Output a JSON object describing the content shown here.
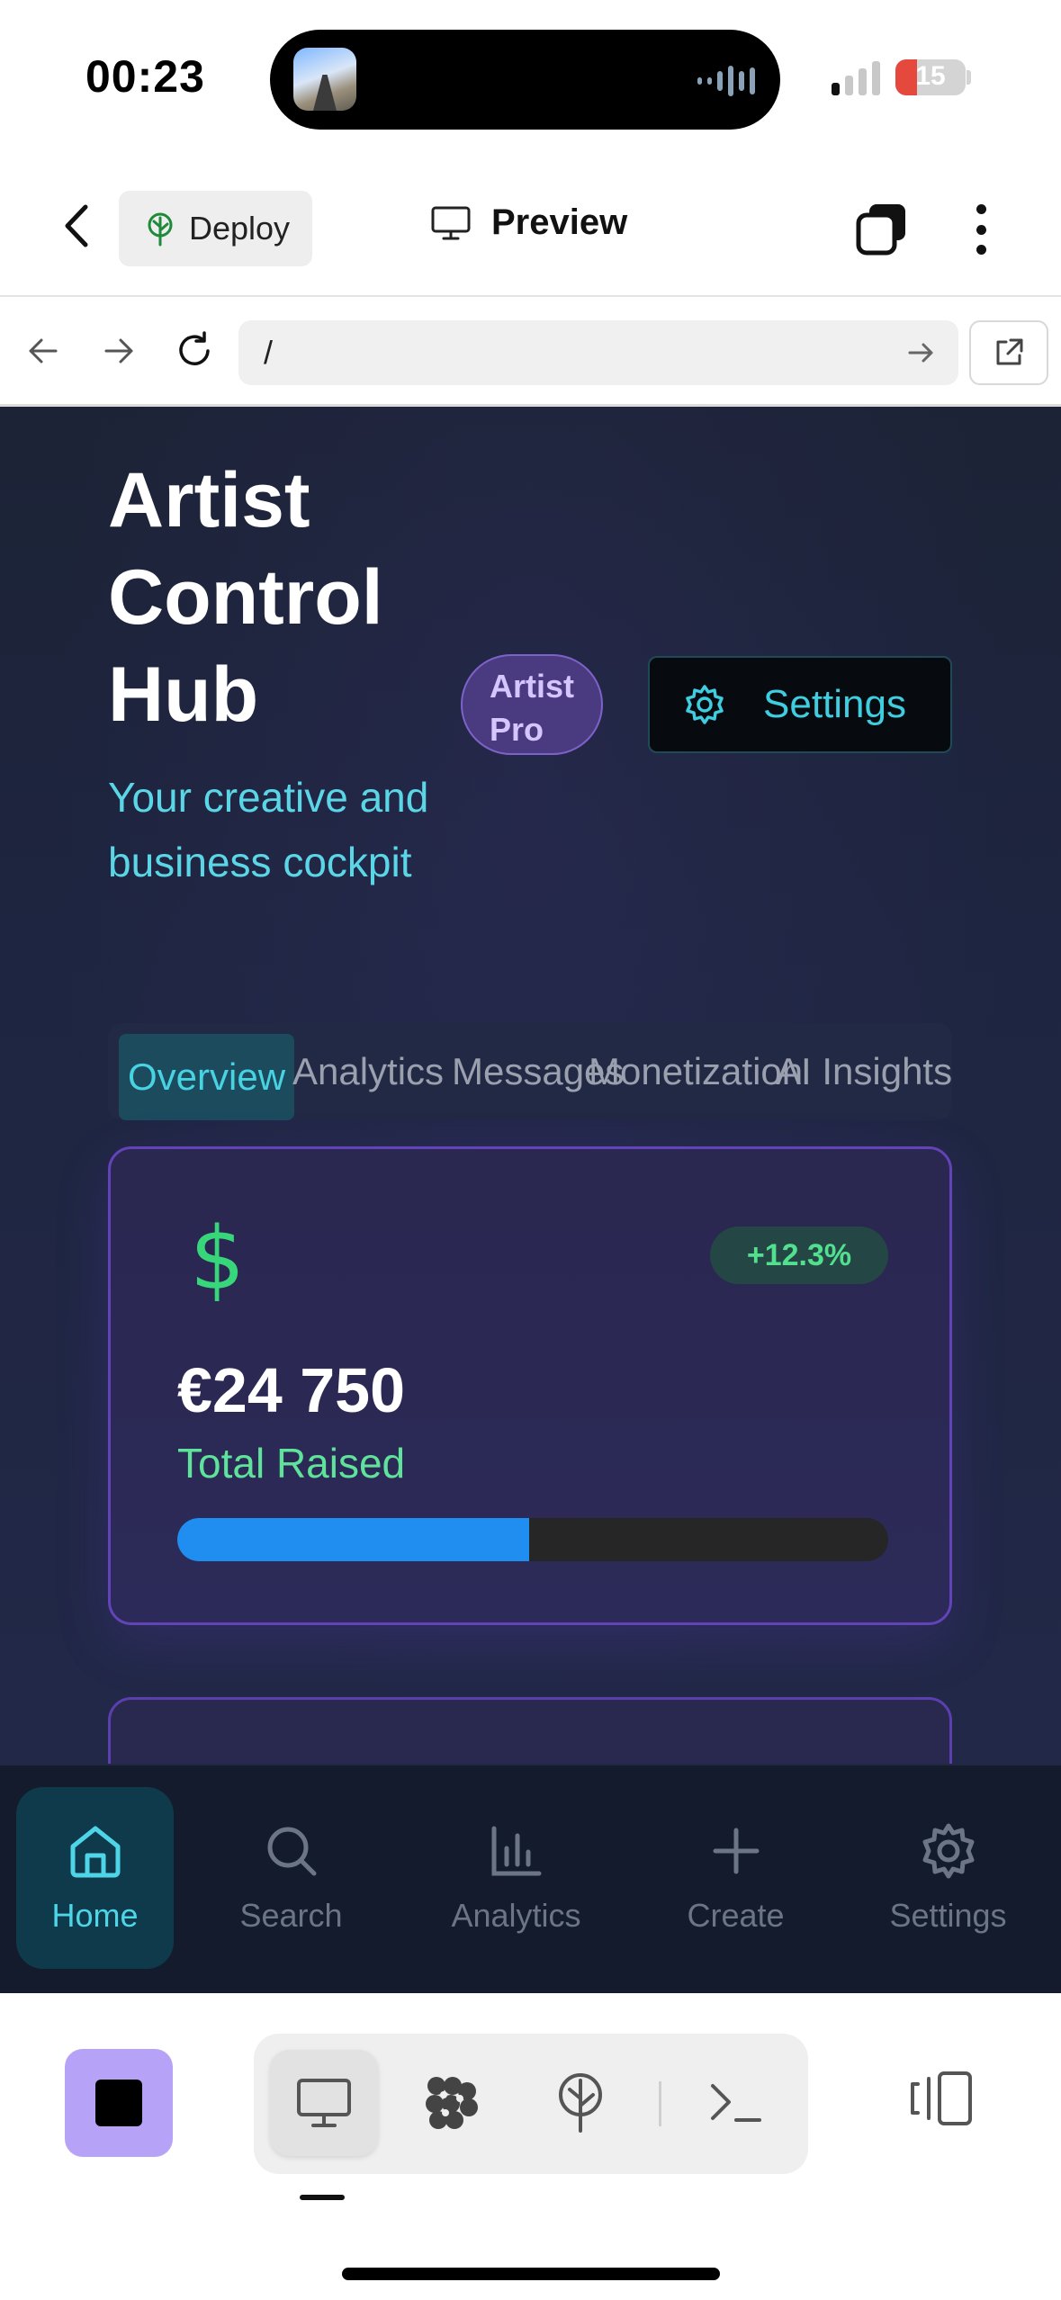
{
  "status_bar": {
    "time": "00:23",
    "battery": "15"
  },
  "toolbar": {
    "deploy_label": "Deploy",
    "preview_label": "Preview"
  },
  "browser": {
    "url": "/"
  },
  "app": {
    "title": "Artist Control Hub",
    "title_lines": [
      "Artist",
      "Control",
      "Hub"
    ],
    "subtitle": "Your creative and business cockpit",
    "badge": "Artist Pro",
    "settings_label": "Settings",
    "tabs": [
      "Overview",
      "Analytics",
      "Messages",
      "Monetization",
      "AI Insights"
    ],
    "active_tab": "Overview",
    "stat_card": {
      "icon": "dollar-icon",
      "change": "+12.3%",
      "amount": "€24 750",
      "label": "Total Raised",
      "progress": 0.495
    }
  },
  "bottom_nav": {
    "items": [
      {
        "label": "Home",
        "icon": "home-icon",
        "active": true
      },
      {
        "label": "Search",
        "icon": "search-icon"
      },
      {
        "label": "Analytics",
        "icon": "bar-chart-icon"
      },
      {
        "label": "Create",
        "icon": "plus-icon"
      },
      {
        "label": "Settings",
        "icon": "gear-icon"
      }
    ]
  },
  "colors": {
    "accent_cyan": "#48d3e3",
    "accent_green": "#52e08f",
    "progress_blue": "#1f8ef0",
    "badge_purple": "#4a3a80",
    "stop_purple": "#b6a3f7"
  }
}
